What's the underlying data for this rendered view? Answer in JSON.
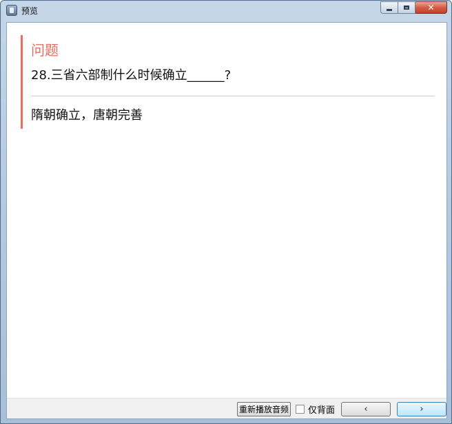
{
  "window": {
    "title": "预览"
  },
  "card": {
    "heading": "问题",
    "question": "28.三省六部制什么时候确立______?",
    "answer": "隋朝确立，唐朝完善"
  },
  "footer": {
    "replay_label": "重新播放音频",
    "back_only_label": "仅背面",
    "back_only_checked": false,
    "prev_glyph": "‹",
    "next_glyph": "›"
  },
  "colors": {
    "accent": "#e76d5f"
  }
}
